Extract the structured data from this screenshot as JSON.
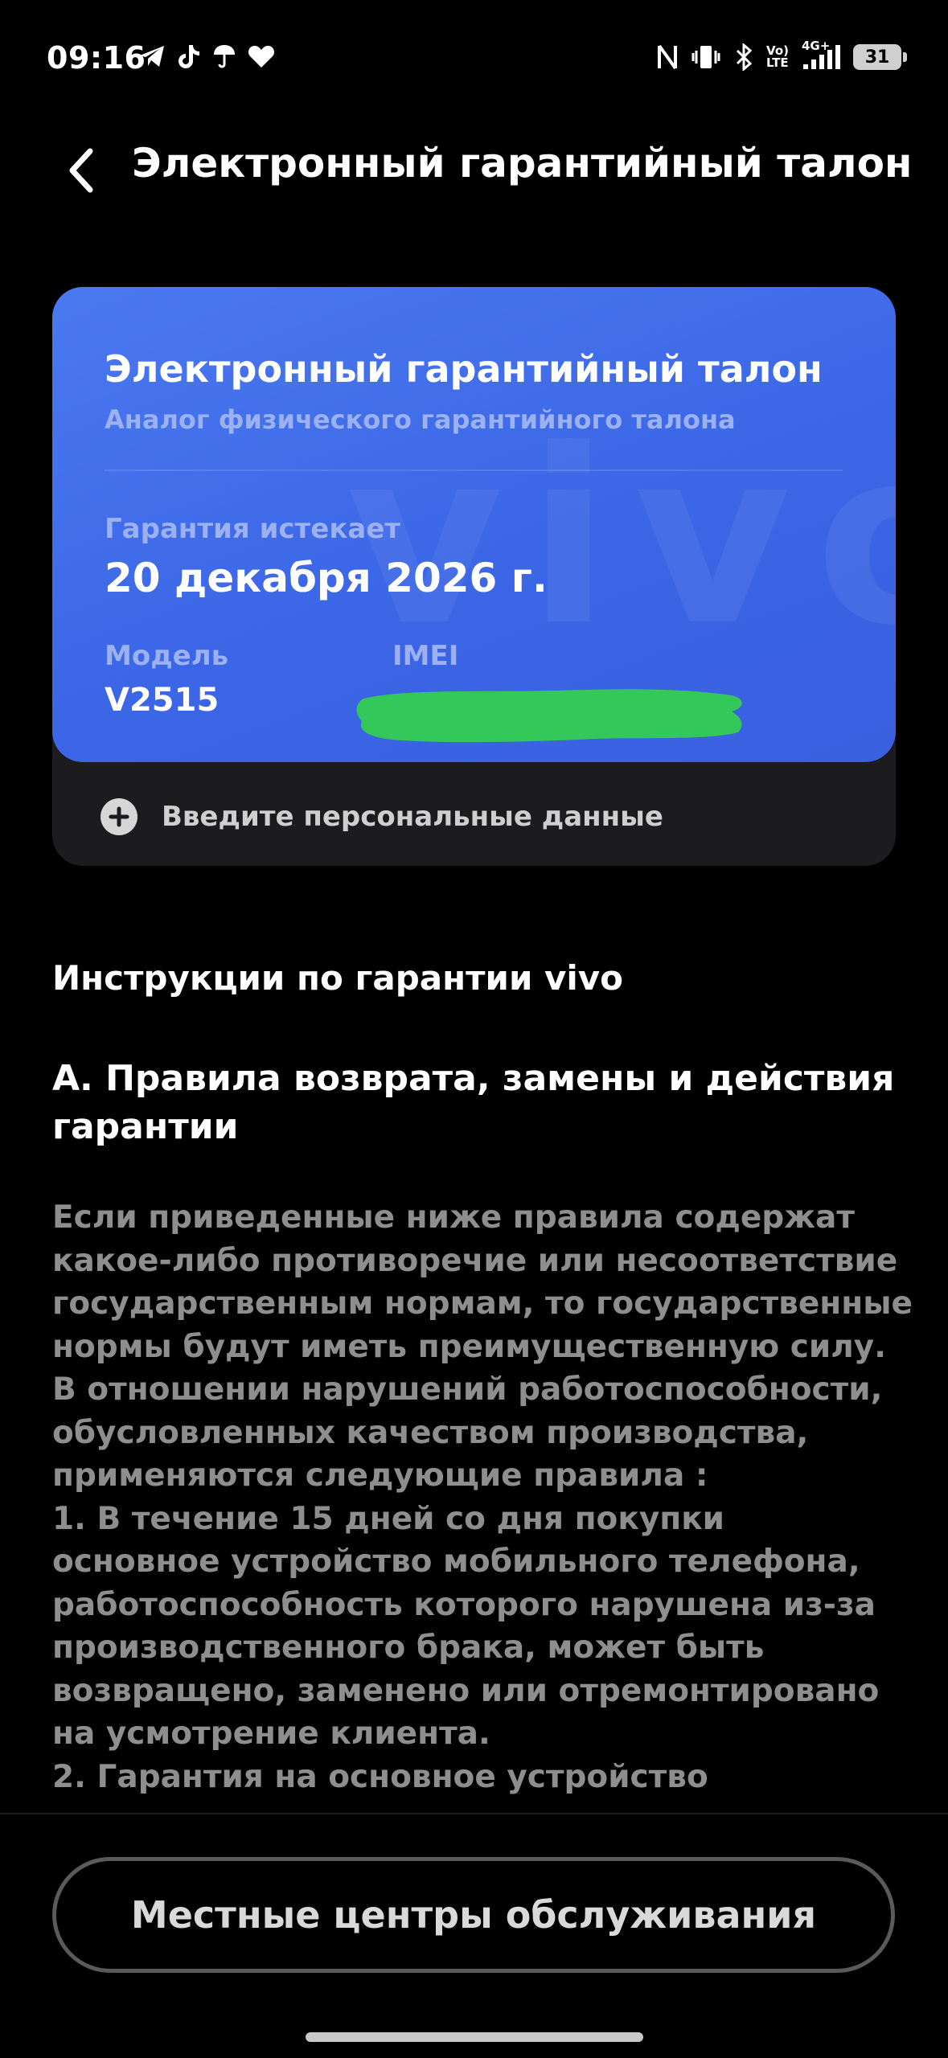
{
  "status_bar": {
    "time": "09:16",
    "network_top": "Vo)",
    "network_bottom": "LTE",
    "signal_type": "4G+",
    "battery": "31",
    "left_icons": [
      "telegram-icon",
      "tiktok-icon",
      "umbrella-icon",
      "heart-icon"
    ],
    "right_icons": [
      "nfc-icon",
      "vibrate-icon",
      "bluetooth-icon",
      "signal-icon",
      "battery-icon"
    ]
  },
  "header": {
    "title": "Электронный гарантийный талон"
  },
  "card": {
    "title": "Электронный гарантийный талон",
    "subtitle": "Аналог физического гарантийного талона",
    "expires_label": "Гарантия истекает",
    "expires_value": "20 декабря 2026 г.",
    "model_label": "Модель",
    "model_value": "V2515",
    "imei_label": "IMEI",
    "watermark": "vivo",
    "colors": {
      "card_blue": "#3b66e6",
      "label_blue": "#9bb1f2",
      "redaction_green": "#34c759"
    }
  },
  "personal_data": {
    "label": "Введите персональные данные"
  },
  "instructions": {
    "heading": "Инструкции по гарантии vivo",
    "rules_heading": "А. Правила возврата, замены и действия гарантии",
    "body_lines": [
      "Если приведенные ниже правила содержат",
      "какое-либо противоречие или несоответствие",
      "государственным нормам, то государственные",
      "нормы будут иметь преимущественную силу.",
      "В отношении нарушений работоспособности,",
      "обусловленных качеством производства,",
      "применяются следующие правила :",
      "1. В течение 15 дней со дня покупки",
      "основное устройство мобильного телефона,",
      "работоспособность которого нарушена из-за",
      "производственного брака, может быть",
      "возвращено, заменено или отремонтировано",
      "на усмотрение клиента.",
      "2. Гарантия на основное устройство"
    ]
  },
  "footer": {
    "button_label": "Местные центры обслуживания"
  }
}
